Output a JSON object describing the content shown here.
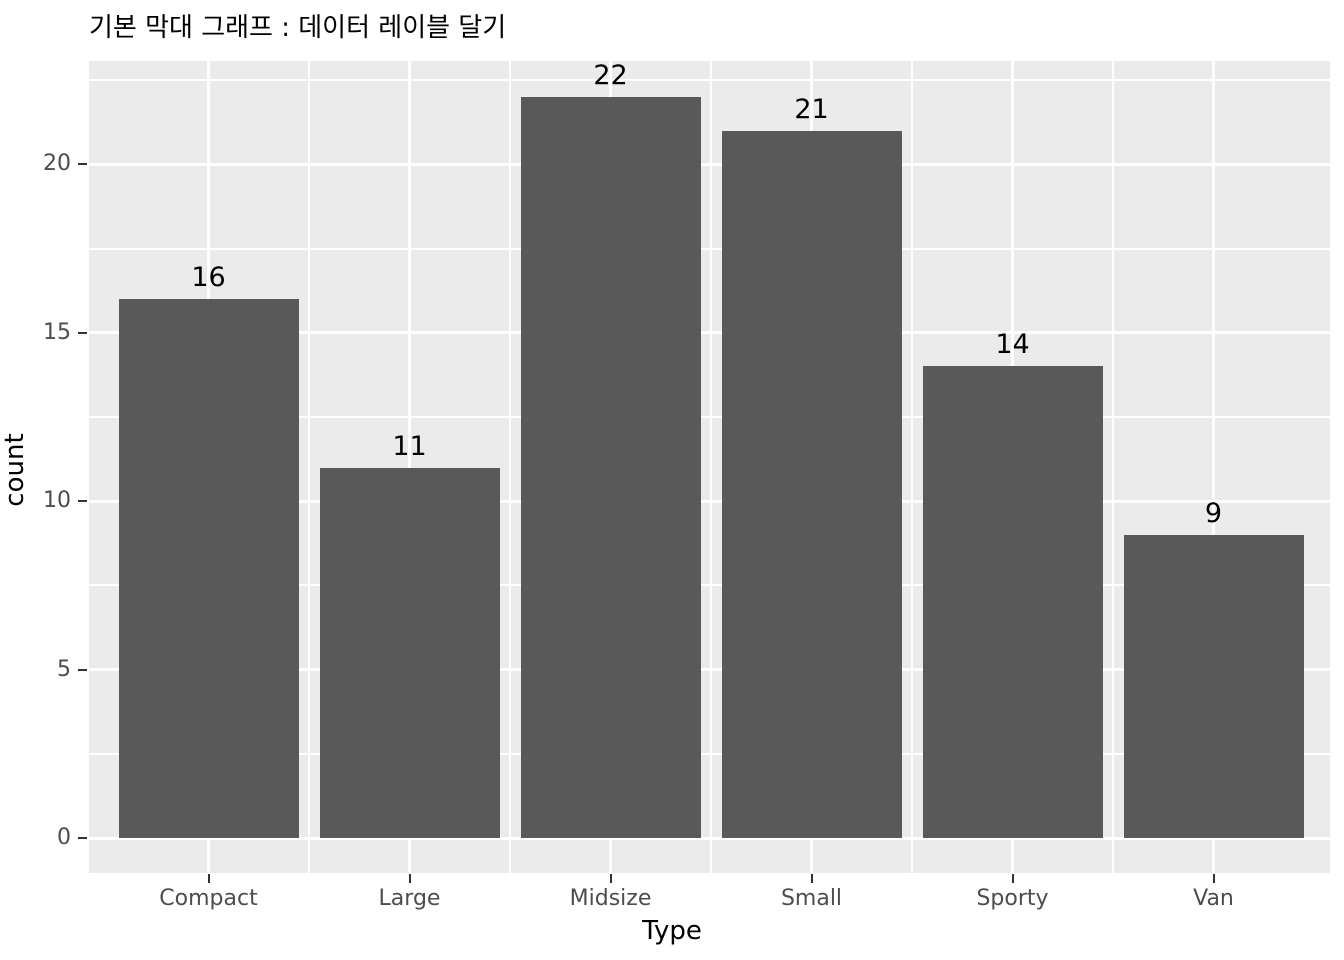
{
  "chart_data": {
    "type": "bar",
    "title": "기본 막대 그래프 : 데이터 레이블 달기",
    "xlabel": "Type",
    "ylabel": "count",
    "categories": [
      "Compact",
      "Large",
      "Midsize",
      "Small",
      "Sporty",
      "Van"
    ],
    "values": [
      16,
      11,
      22,
      21,
      14,
      9
    ],
    "data_labels": [
      "16",
      "11",
      "22",
      "21",
      "14",
      "9"
    ],
    "y_ticks": [
      0,
      5,
      10,
      15,
      20
    ],
    "y_tick_labels": [
      "0",
      "5",
      "10",
      "15",
      "20"
    ],
    "y_minor_ticks": [
      2.5,
      7.5,
      12.5,
      17.5,
      22.5
    ],
    "ylim": [
      0,
      23.1
    ],
    "grid": true,
    "legend": "none",
    "colors": {
      "bar": "#595959",
      "panel_background": "#EBEBEB",
      "gridline": "#FFFFFF",
      "axis_text": "#4D4D4D",
      "title_text": "#000000",
      "plot_background": "#FFFFFF"
    }
  }
}
